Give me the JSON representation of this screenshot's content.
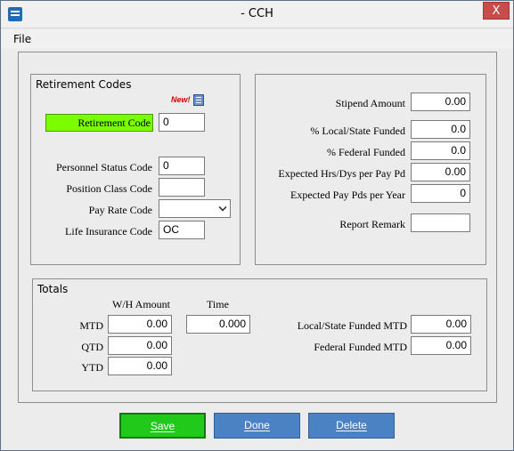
{
  "window": {
    "title": "- CCH",
    "close_glyph": "X"
  },
  "menu": {
    "file": "File"
  },
  "retirement_codes": {
    "title": "Retirement Codes",
    "new_badge": "New!",
    "retirement_code_label": "Retirement Code",
    "retirement_code_value": "0",
    "personnel_status_label": "Personnel Status Code",
    "personnel_status_value": "0",
    "position_class_label": "Position Class Code",
    "position_class_value": "",
    "pay_rate_label": "Pay Rate  Code",
    "pay_rate_value": "",
    "life_insurance_label": "Life Insurance Code",
    "life_insurance_value": "OC"
  },
  "funding": {
    "stipend_label": "Stipend Amount",
    "stipend_value": "0.00",
    "local_state_label": "% Local/State Funded",
    "local_state_value": "0.0",
    "federal_label": "% Federal Funded",
    "federal_value": "0.0",
    "hrs_label": "Expected Hrs/Dys per Pay Pd",
    "hrs_value": "0.00",
    "pay_pds_label": "Expected Pay Pds per Year",
    "pay_pds_value": "0",
    "report_remark_label": "Report Remark",
    "report_remark_value": ""
  },
  "totals": {
    "title": "Totals",
    "wh_amount_header": "W/H Amount",
    "time_header": "Time",
    "mtd_label": "MTD",
    "mtd_value": "0.00",
    "mtd_time_value": "0.000",
    "qtd_label": "QTD",
    "qtd_value": "0.00",
    "ytd_label": "YTD",
    "ytd_value": "0.00",
    "local_state_mtd_label": "Local/State Funded MTD",
    "local_state_mtd_value": "0.00",
    "federal_mtd_label": "Federal Funded MTD",
    "federal_mtd_value": "0.00"
  },
  "buttons": {
    "save": "Save",
    "done": "Done",
    "delete": "Delete"
  },
  "colors": {
    "retirement_label_bg": "#7cfc00",
    "save_bg": "#21c91b",
    "action_bg": "#4b82c4",
    "close_bg": "#c74d4d"
  }
}
